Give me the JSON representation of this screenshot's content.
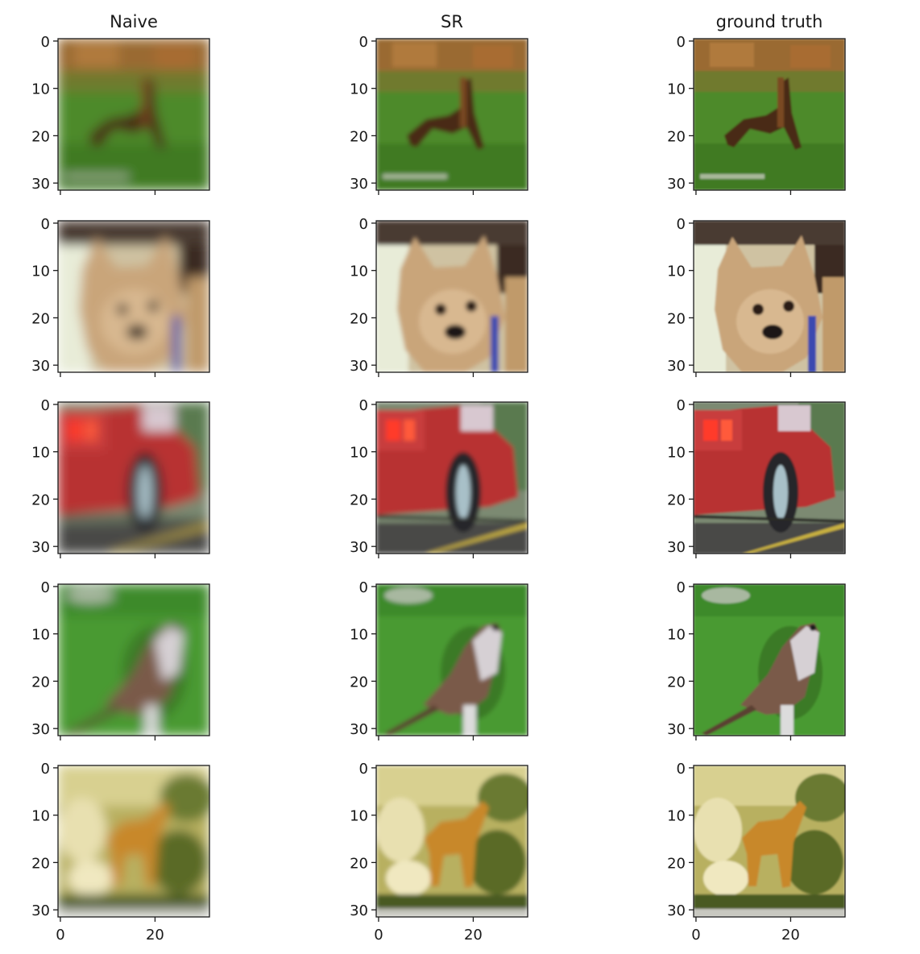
{
  "figure": {
    "columns": [
      {
        "title": "Naive"
      },
      {
        "title": "SR"
      },
      {
        "title": "ground truth"
      }
    ],
    "rows": [
      {
        "subject": "deer on grass"
      },
      {
        "subject": "dog"
      },
      {
        "subject": "red car"
      },
      {
        "subject": "bird"
      },
      {
        "subject": "deer in foliage"
      }
    ],
    "y_ticks": [
      "0",
      "10",
      "20",
      "30"
    ],
    "x_ticks": [
      "0",
      "20"
    ],
    "image_size": 32,
    "colors": {
      "axes": "#1a1a1a",
      "text": "#1a1a1a",
      "background": "#ffffff"
    }
  }
}
